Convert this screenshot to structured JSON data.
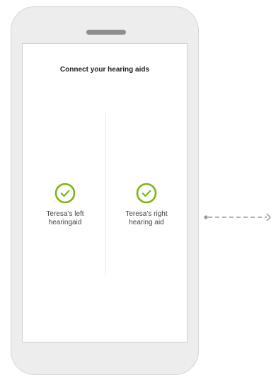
{
  "screen": {
    "title": "Connect your hearing aids"
  },
  "hearing_aids": {
    "left": {
      "line1": "Teresa’s left",
      "line2": "hearingaid",
      "status_icon": "check-circle-icon"
    },
    "right": {
      "line1": "Teresa’s right",
      "line2": "hearing aid",
      "status_icon": "check-circle-icon"
    }
  },
  "colors": {
    "accent": "#7cb518",
    "phone_body": "#ededed",
    "phone_border": "#d6d6d6",
    "speaker": "#8e8e8e",
    "connector": "#9a9a9a"
  }
}
